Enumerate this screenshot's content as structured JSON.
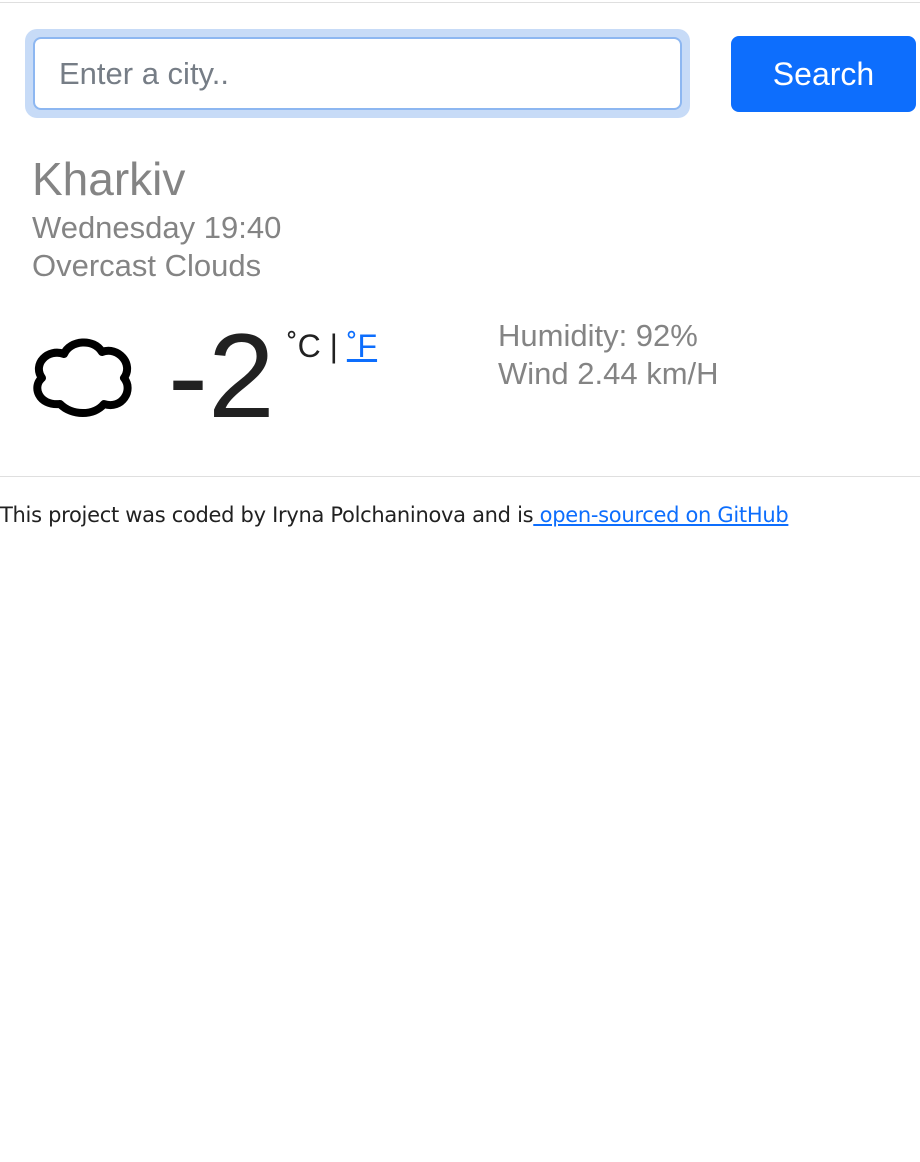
{
  "search": {
    "placeholder": "Enter a city..",
    "value": "",
    "button_label": "Search"
  },
  "weather": {
    "city": "Kharkiv",
    "datetime": "Wednesday 19:40",
    "description": "Overcast Clouds",
    "icon": "cloud-icon",
    "temperature": "-2",
    "unit_celsius": "˚C",
    "unit_separator": " | ",
    "unit_fahrenheit": "˚F",
    "humidity": "Humidity: 92%",
    "wind": "Wind 2.44 km/H"
  },
  "footer": {
    "text": "This project was coded by Iryna Polchaninova and is",
    "link_text": " open-sourced on GitHub"
  },
  "colors": {
    "accent": "#0d6efd",
    "muted_text": "#848484",
    "main_text": "#212121"
  }
}
